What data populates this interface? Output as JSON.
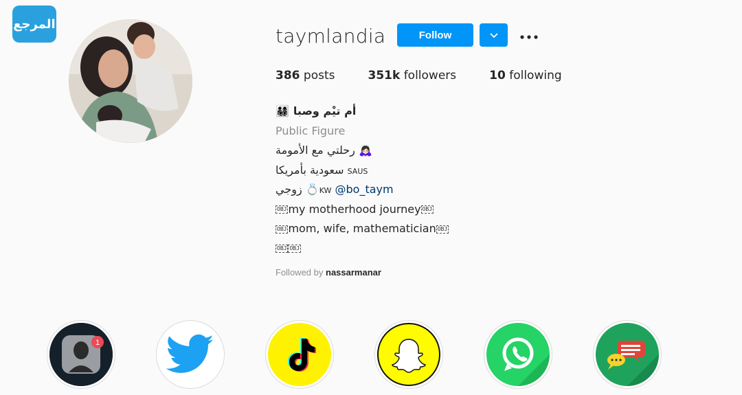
{
  "watermark": {
    "text": "المرجع"
  },
  "profile": {
    "username": "taymlandia",
    "follow_label": "Follow",
    "stats": {
      "posts_count": "386",
      "posts_label": "posts",
      "followers_count": "351k",
      "followers_label": "followers",
      "following_count": "10",
      "following_label": "following"
    },
    "full_name": "أم تيْم وصبا",
    "category": "Public Figure",
    "bio": {
      "line1": "رحلتي مع الأمومة",
      "line2_text": "سعودية بأمريكا",
      "line2_flag": "SAUS",
      "line3_text": "زوجي",
      "line3_flag": "KW",
      "line3_mention": "@bo_taym",
      "line4": "my motherhood journey",
      "line5": "mom, wife, mathematician",
      "obj_marker": "OBJ"
    },
    "followed_by_prefix": "Followed by",
    "followed_by_user": "nassarmanar"
  },
  "highlights": [
    {
      "name": "profile-app-icon",
      "badge": "1"
    },
    {
      "name": "twitter-icon"
    },
    {
      "name": "tiktok-icon"
    },
    {
      "name": "snapchat-icon"
    },
    {
      "name": "whatsapp-icon"
    },
    {
      "name": "chat-bubbles-icon"
    }
  ],
  "colors": {
    "follow_blue": "#0095f6",
    "twitter_blue": "#1da1f2",
    "tiktok_yellow": "#fff200",
    "snapchat_yellow": "#fffc00",
    "whatsapp_green": "#25d366",
    "chat_green": "#1fa35c",
    "mention_blue": "#00376b"
  }
}
